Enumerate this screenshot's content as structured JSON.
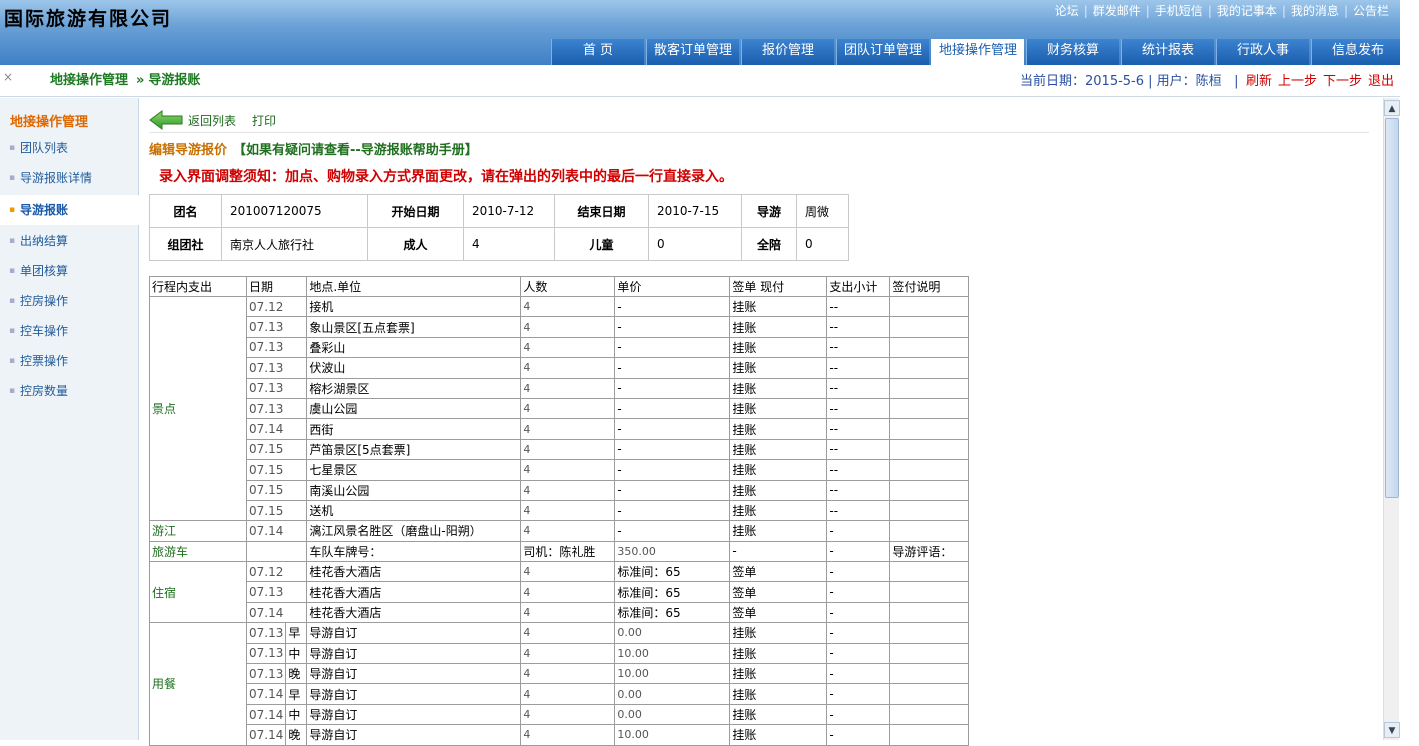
{
  "app": {
    "title": "国际旅游有限公司"
  },
  "toplinks": [
    "论坛",
    "群发邮件",
    "手机短信",
    "我的记事本",
    "我的消息",
    "公告栏"
  ],
  "nav": [
    "首 页",
    "散客订单管理",
    "报价管理",
    "团队订单管理",
    "地接操作管理",
    "财务核算",
    "统计报表",
    "行政人事",
    "信息发布"
  ],
  "breadcrumb": {
    "close": "×",
    "section": "地接操作管理",
    "sep": "»",
    "page": "导游报账"
  },
  "status": {
    "date_label": "当前日期：2015-5-6 | 用户：陈桓",
    "bar": "|"
  },
  "actions": [
    "刷新",
    "上一步",
    "下一步",
    "退出"
  ],
  "sidebar": {
    "title": "地接操作管理",
    "items": [
      "团队列表",
      "导游报账详情",
      "导游报账",
      "出纳结算",
      "单团核算",
      "控房操作",
      "控车操作",
      "控票操作",
      "控房数量"
    ]
  },
  "toolbar": {
    "back": "返回列表",
    "print": "打印"
  },
  "edit": {
    "title": "编辑导游报价",
    "help": "【如果有疑问请查看--导游报账帮助手册】"
  },
  "notice": "录入界面调整须知：加点、购物录入方式界面更改，请在弹出的列表中的最后一行直接录入。",
  "info": {
    "group_label": "团名",
    "group": "201007120075",
    "start_label": "开始日期",
    "start": "2010-7-12",
    "end_label": "结束日期",
    "end": "2010-7-15",
    "guide_label": "导游",
    "guide": "周微",
    "agency_label": "组团社",
    "agency": "南京人人旅行社",
    "adult_label": "成人",
    "adult": "4",
    "child_label": "儿童",
    "child": "0",
    "full_label": "全陪",
    "full": "0"
  },
  "table": {
    "headers": [
      "行程内支出",
      "日期",
      "地点.单位",
      "人数",
      "单价",
      "签单 现付",
      "支出小计",
      "签付说明"
    ],
    "categories": {
      "scenic": "景点",
      "river": "游江",
      "bus": "旅游车",
      "hotel": "住宿",
      "meal": "用餐"
    },
    "scenic": [
      [
        "07.12",
        "接机",
        "4",
        "-",
        "挂账",
        "--"
      ],
      [
        "07.13",
        "象山景区[五点套票]",
        "4",
        "-",
        "挂账",
        "--"
      ],
      [
        "07.13",
        "叠彩山",
        "4",
        "-",
        "挂账",
        "--"
      ],
      [
        "07.13",
        "伏波山",
        "4",
        "-",
        "挂账",
        "--"
      ],
      [
        "07.13",
        "榕杉湖景区",
        "4",
        "-",
        "挂账",
        "--"
      ],
      [
        "07.13",
        "虞山公园",
        "4",
        "-",
        "挂账",
        "--"
      ],
      [
        "07.14",
        "西街",
        "4",
        "-",
        "挂账",
        "--"
      ],
      [
        "07.15",
        "芦笛景区[5点套票]",
        "4",
        "-",
        "挂账",
        "--"
      ],
      [
        "07.15",
        "七星景区",
        "4",
        "-",
        "挂账",
        "--"
      ],
      [
        "07.15",
        "南溪山公园",
        "4",
        "-",
        "挂账",
        "--"
      ],
      [
        "07.15",
        "送机",
        "4",
        "-",
        "挂账",
        "--"
      ]
    ],
    "river": [
      "07.14",
      "漓江风景名胜区（磨盘山-阳朔）",
      "4",
      "-",
      "挂账",
      "-"
    ],
    "bus": {
      "plate": "车队车牌号：",
      "driver": "司机：陈礼胜",
      "price": "350.00",
      "pay": "-",
      "sub": "-",
      "note": "导游评语："
    },
    "hotel": [
      [
        "07.12",
        "桂花香大酒店",
        "4",
        "标准间：65",
        "签单",
        "-"
      ],
      [
        "07.13",
        "桂花香大酒店",
        "4",
        "标准间：65",
        "签单",
        "-"
      ],
      [
        "07.14",
        "桂花香大酒店",
        "4",
        "标准间：65",
        "签单",
        "-"
      ]
    ],
    "meal": [
      [
        "07.13",
        "早",
        "导游自订",
        "4",
        "0.00",
        "挂账",
        "-"
      ],
      [
        "07.13",
        "中",
        "导游自订",
        "4",
        "10.00",
        "挂账",
        "-"
      ],
      [
        "07.13",
        "晚",
        "导游自订",
        "4",
        "10.00",
        "挂账",
        "-"
      ],
      [
        "07.14",
        "早",
        "导游自订",
        "4",
        "0.00",
        "挂账",
        "-"
      ],
      [
        "07.14",
        "中",
        "导游自订",
        "4",
        "0.00",
        "挂账",
        "-"
      ],
      [
        "07.14",
        "晚",
        "导游自订",
        "4",
        "10.00",
        "挂账",
        "-"
      ]
    ]
  },
  "scrollbar": {
    "up": "▲",
    "down": "▼"
  },
  "colors": {
    "nav_blue": "#1a5eae",
    "alert_red": "#d00000",
    "green": "#207020",
    "orange": "#e06800"
  }
}
